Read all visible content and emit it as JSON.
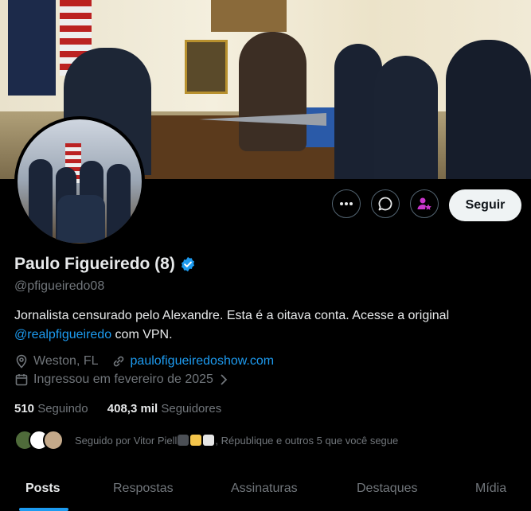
{
  "profile": {
    "name": "Paulo Figueiredo (8)",
    "handle": "@pfigueiredo08",
    "bio_text": "Jornalista censurado pelo Alexandre. Esta é a oitava conta. Acesse a original",
    "bio_link": "@realpfigueiredo",
    "bio_suffix": " com VPN.",
    "location": "Weston, FL",
    "website": "paulofigueiredoshow.com",
    "joined": "Ingressou em fevereiro de 2025",
    "following_count": "510",
    "following_label": "Seguindo",
    "followers_count": "408,3 mil",
    "followers_label": "Seguidores",
    "followed_by_prefix": "Seguido por Vitor Piell",
    "followed_by_suffix": ", République e outros 5 que você segue"
  },
  "actions": {
    "follow_label": "Seguir",
    "more_icon": "more-icon",
    "message_icon": "message-icon",
    "subscribe_icon": "subscribe-icon"
  },
  "tabs": [
    {
      "label": "Posts",
      "active": true
    },
    {
      "label": "Respostas"
    },
    {
      "label": "Assinaturas"
    },
    {
      "label": "Destaques"
    },
    {
      "label": "Mídia"
    }
  ],
  "colors": {
    "background": "#000000",
    "accent": "#1d9bf0",
    "subscribe": "#c936cc",
    "muted_text": "#71767b"
  }
}
